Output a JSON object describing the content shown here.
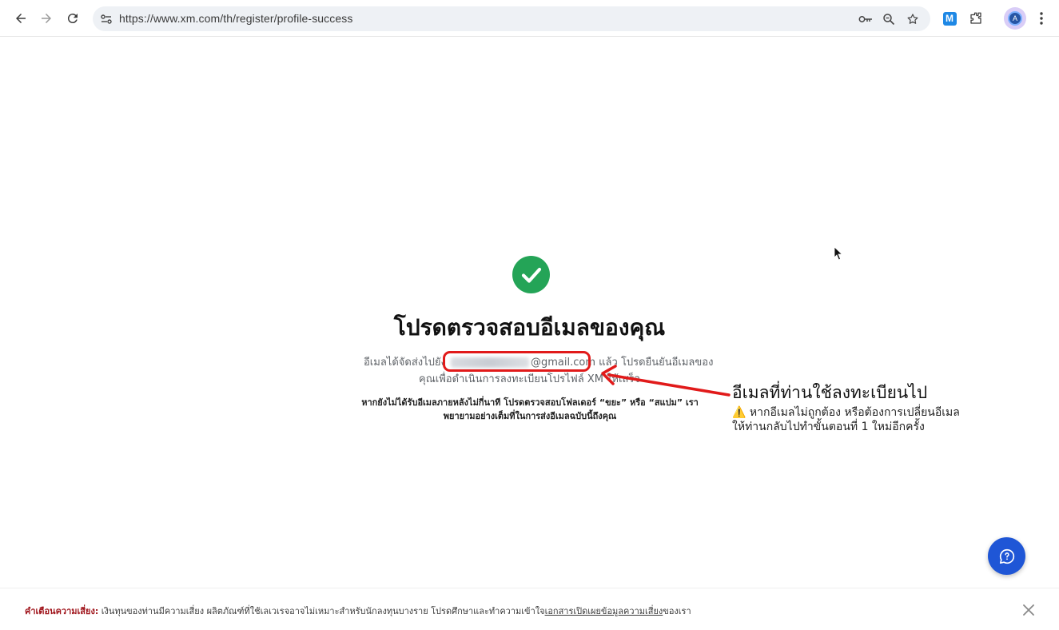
{
  "browser": {
    "url": "https://www.xm.com/th/register/profile-success",
    "icons": [
      "back-icon",
      "forward-icon",
      "reload-icon",
      "site-info-icon",
      "password-key-icon",
      "zoom-icon",
      "star-icon",
      "extension-m-icon",
      "extensions-puzzle-icon",
      "profile-avatar",
      "menu-kebab-icon"
    ],
    "extension_label": "M",
    "avatar_initial": "A"
  },
  "main": {
    "heading": "โปรดตรวจสอบอีเมลของคุณ",
    "line1_prefix": "อีเมลได้จัดส่งไปยัง",
    "email_domain": "@gmail.com",
    "line1_suffix": "แล้ว โปรดยืนยันอีเมลของ",
    "line2": "คุณเพื่อดำเนินการลงทะเบียนโปรไฟล์ XM ให้เสร็จ",
    "note_line1": "หากยังไม่ได้รับอีเมลภายหลังไม่กี่นาที โปรดตรวจสอบโฟลเดอร์ “ขยะ” หรือ “สแปม” เรา",
    "note_line2": "พยายามอย่างเต็มที่ในการส่งอีเมลฉบับนี้ถึงคุณ"
  },
  "annotation": {
    "title": "อีเมลที่ท่านใช้ลงทะเบียนไป",
    "warn_icon": "⚠️",
    "warn_line1": "หากอีเมลไม่ถูกต้อง หรือต้องการเปลี่ยนอีเมล",
    "warn_line2": "ให้ท่านกลับไปทำขั้นตอนที่ 1 ใหม่อีกครั้ง",
    "color": "#e11a1a"
  },
  "risk": {
    "label": "คำเตือนความเสี่ยง:",
    "text": " เงินทุนของท่านมีความเสี่ยง ผลิตภัณฑ์ที่ใช้เลเวเรจอาจไม่เหมาะสำหรับนักลงทุนบางราย โปรดศึกษาและทำความเข้าใจ",
    "link": "เอกสารเปิดเผยข้อมูลความเสี่ยง",
    "suffix": "ของเรา"
  },
  "colors": {
    "success": "#24a457",
    "chat": "#1f56d6",
    "risk_label": "#a0151c"
  }
}
